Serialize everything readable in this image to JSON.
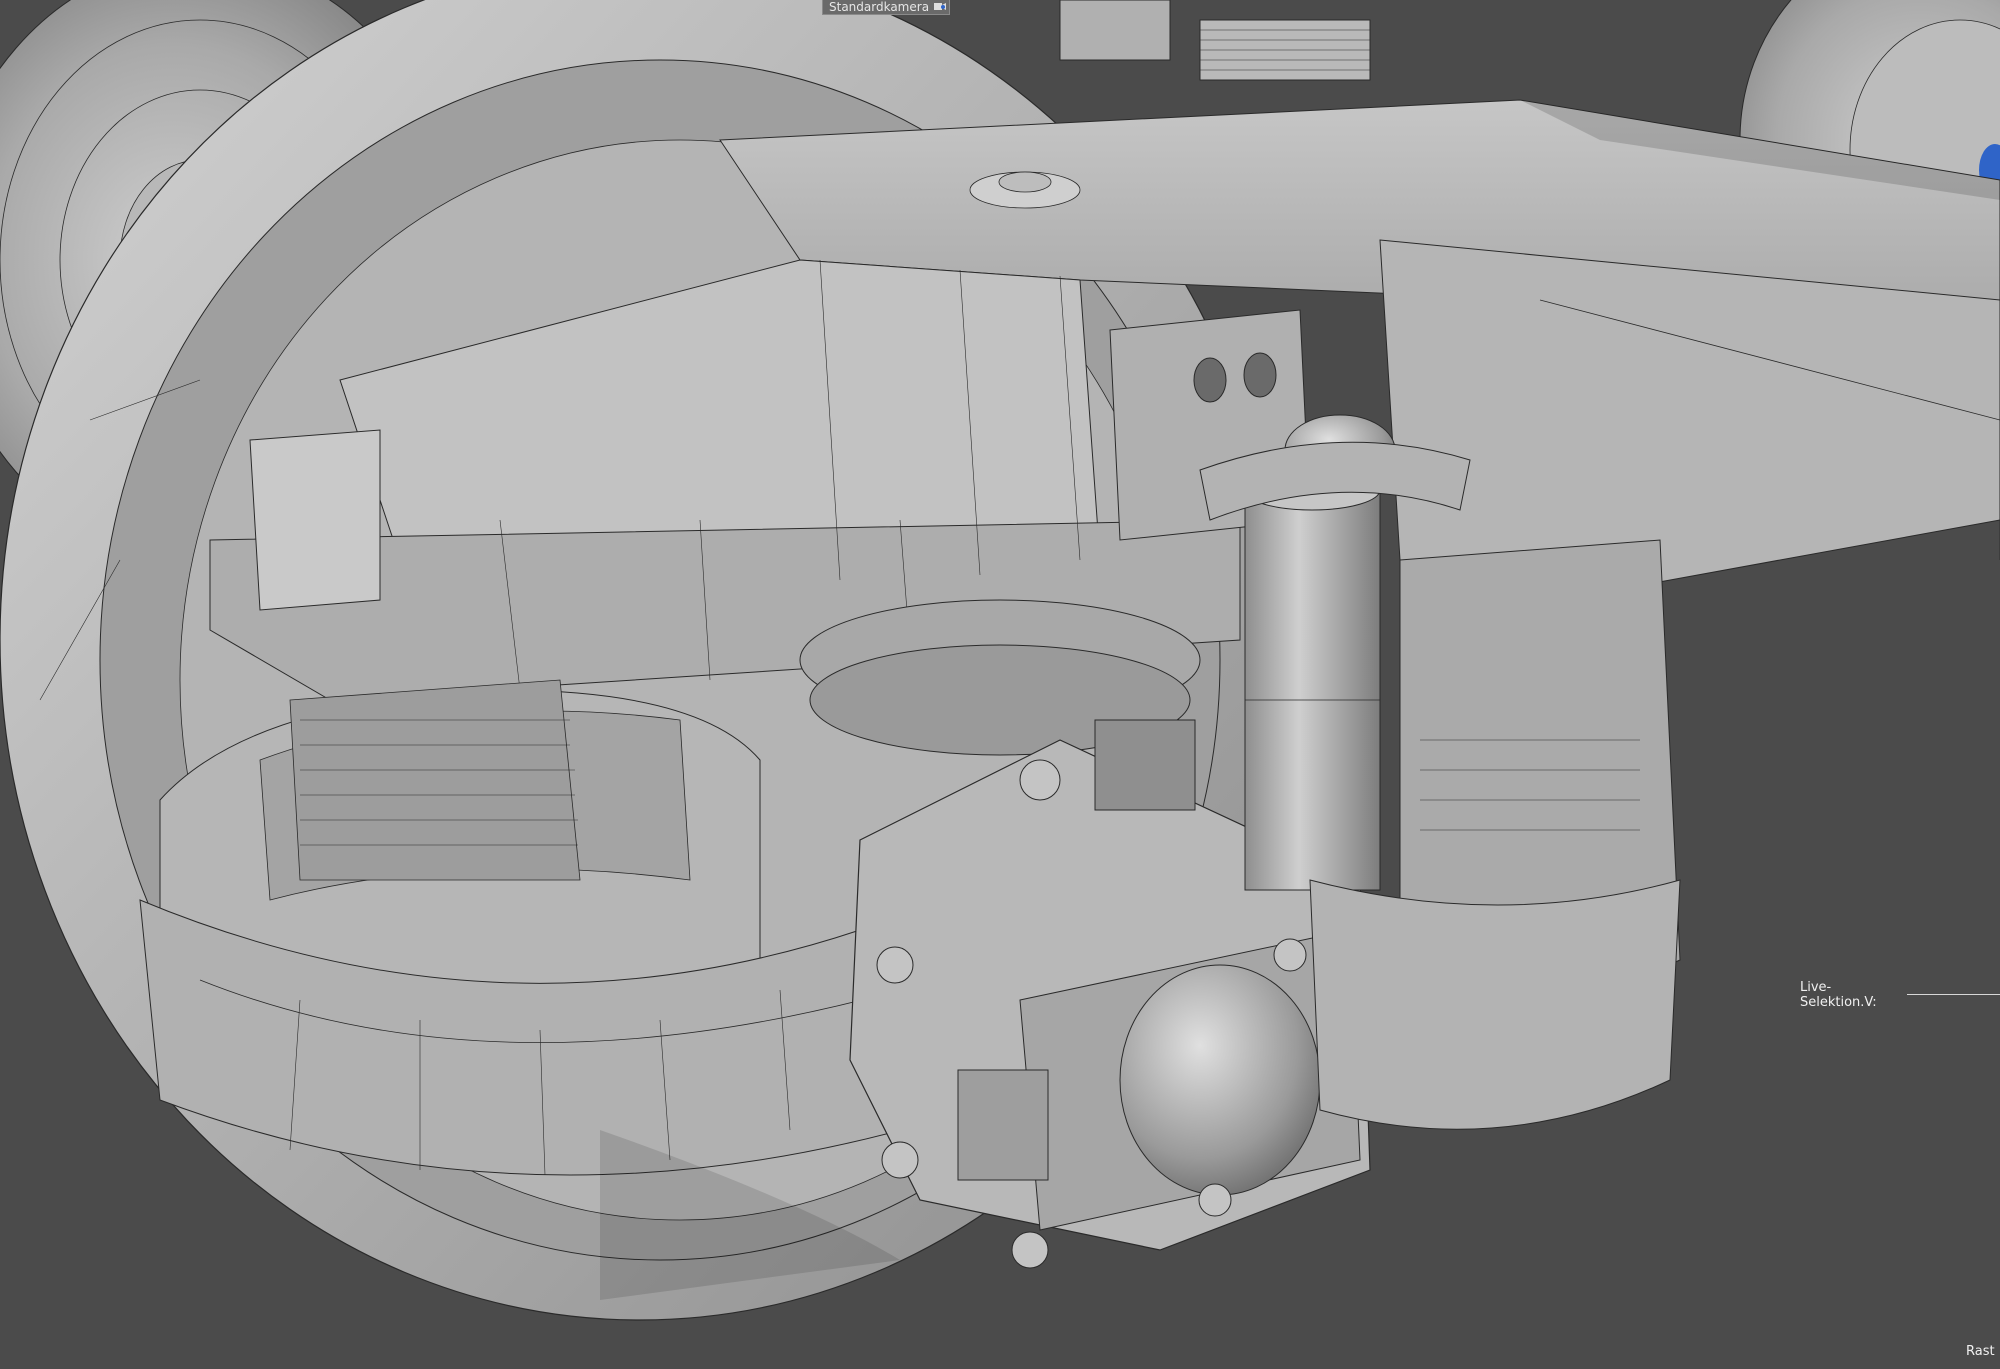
{
  "viewport": {
    "camera_label": "Standardkamera",
    "camera_icon": "camera-icon",
    "background_color": "#4a4a4a",
    "model_color": "#bdbdbd",
    "wire_color": "#2a2a2a",
    "accent_color": "#2f64c8"
  },
  "hud": {
    "live_selection_label": "Live-Selektion.V:",
    "raster_label": "Rast"
  }
}
